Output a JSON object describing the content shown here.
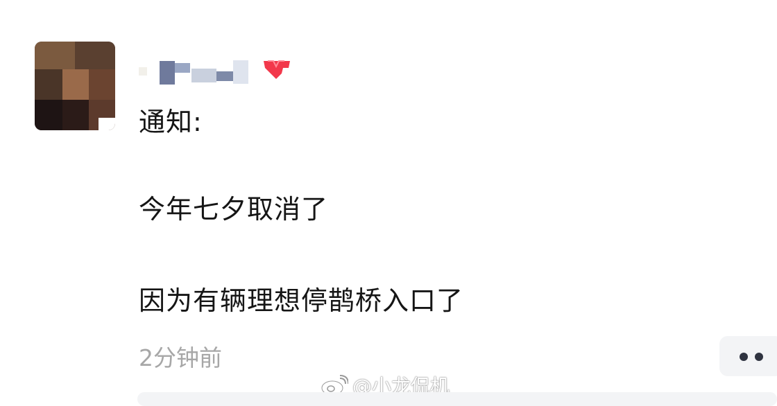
{
  "post": {
    "title": "通知:",
    "line1": "今年七夕取消了",
    "line2": "因为有辆理想停鹊桥入口了",
    "time": "2分钟前"
  },
  "watermark": {
    "text": "@小龙侃机"
  },
  "icons": {
    "avatar": "pixelated-avatar",
    "badge": "vip-badge-icon",
    "more": "more-dots-icon",
    "weibo": "weibo-logo-icon"
  },
  "colors": {
    "text": "#151515",
    "time": "#a7a7a7",
    "button_bg": "#f3f4f6",
    "badge": "#f2384b"
  }
}
